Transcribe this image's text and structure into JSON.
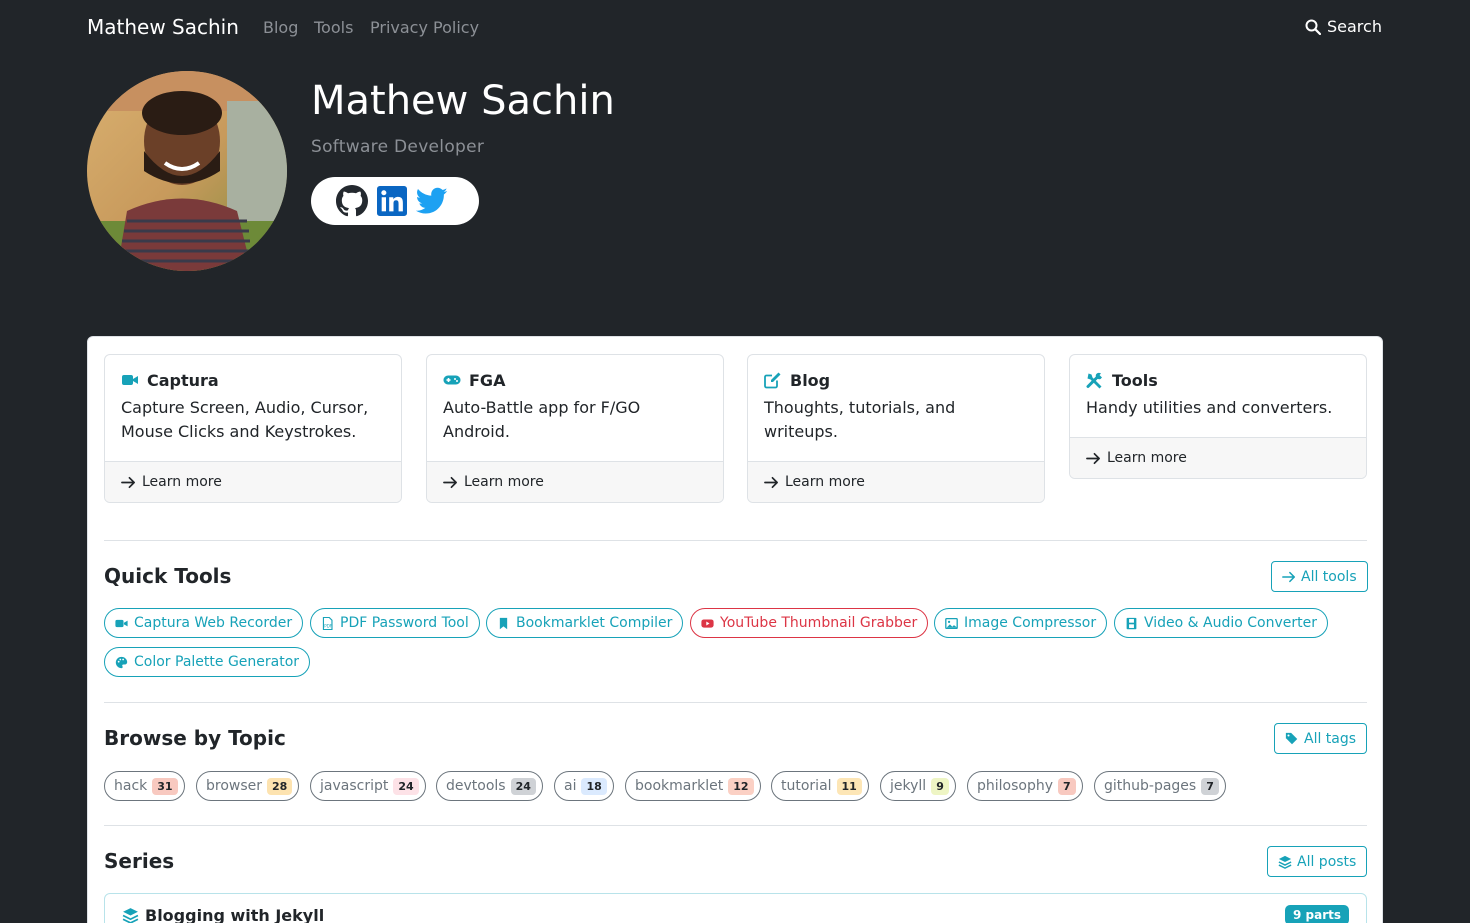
{
  "nav": {
    "brand": "Mathew Sachin",
    "links": [
      "Blog",
      "Tools",
      "Privacy Policy"
    ],
    "search_label": "Search"
  },
  "hero": {
    "name": "Mathew Sachin",
    "subtitle": "Software Developer",
    "social_icons": [
      "github-icon",
      "linkedin-icon",
      "twitter-icon"
    ]
  },
  "features": [
    {
      "icon": "video-camera-icon",
      "title": "Captura",
      "desc": "Capture Screen, Audio, Cursor, Mouse Clicks and Keystrokes.",
      "cta": "Learn more"
    },
    {
      "icon": "gamepad-icon",
      "title": "FGA",
      "desc": "Auto-Battle app for F/GO Android.",
      "cta": "Learn more"
    },
    {
      "icon": "edit-icon",
      "title": "Blog",
      "desc": "Thoughts, tutorials, and writeups.",
      "cta": "Learn more"
    },
    {
      "icon": "tools-icon",
      "title": "Tools",
      "desc": "Handy utilities and converters.",
      "cta": "Learn more"
    }
  ],
  "quick_tools": {
    "title": "Quick Tools",
    "all_label": "All tools",
    "items": [
      {
        "icon": "video-icon",
        "label": "Captura Web Recorder"
      },
      {
        "icon": "pdf-file-icon",
        "label": "PDF Password Tool"
      },
      {
        "icon": "bookmark-icon",
        "label": "Bookmarklet Compiler"
      },
      {
        "icon": "youtube-icon",
        "label": "YouTube Thumbnail Grabber"
      },
      {
        "icon": "image-icon",
        "label": "Image Compressor"
      },
      {
        "icon": "film-icon",
        "label": "Video & Audio Converter"
      },
      {
        "icon": "palette-icon",
        "label": "Color Palette Generator"
      }
    ]
  },
  "topics": {
    "title": "Browse by Topic",
    "all_label": "All tags",
    "items": [
      {
        "label": "hack",
        "count": "31",
        "color": "#f8c9c0"
      },
      {
        "label": "browser",
        "count": "28",
        "color": "#fde3b0"
      },
      {
        "label": "javascript",
        "count": "24",
        "color": "#fde2e7"
      },
      {
        "label": "devtools",
        "count": "24",
        "color": "#cfd2d6"
      },
      {
        "label": "ai",
        "count": "18",
        "color": "#dbeafe"
      },
      {
        "label": "bookmarklet",
        "count": "12",
        "color": "#fbd0c4"
      },
      {
        "label": "tutorial",
        "count": "11",
        "color": "#fde6b6"
      },
      {
        "label": "jekyll",
        "count": "9",
        "color": "#eef5c4"
      },
      {
        "label": "philosophy",
        "count": "7",
        "color": "#f8c9c0"
      },
      {
        "label": "github-pages",
        "count": "7",
        "color": "#cfd2d6"
      }
    ]
  },
  "series": {
    "title": "Series",
    "all_label": "All posts",
    "first": {
      "title": "Blogging with Jekyll",
      "badge": "9 parts"
    }
  },
  "colors": {
    "accent": "#17a2b8",
    "dark_bg": "#212529",
    "red": "#dc3545"
  }
}
